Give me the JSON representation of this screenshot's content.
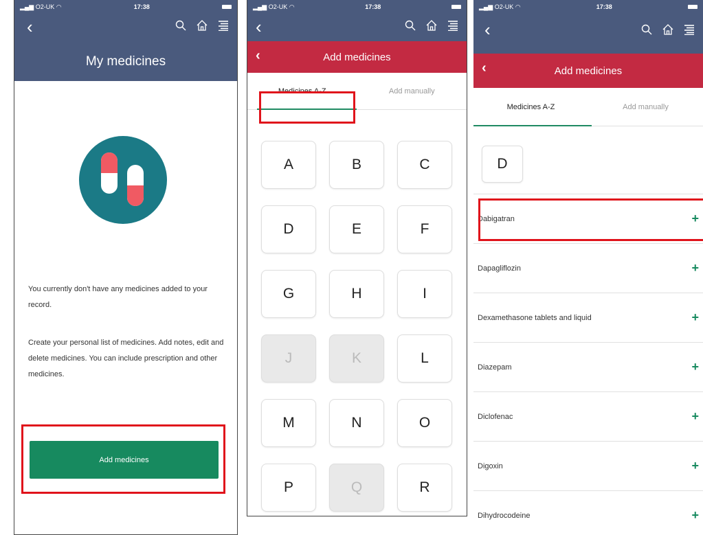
{
  "status": {
    "carrier": "O2-UK",
    "time": "17:38"
  },
  "panel1": {
    "title": "My medicines",
    "text1": "You currently don't have any medicines added to your record.",
    "text2": "Create your personal list of medicines. Add notes, edit and delete medicines. You can include prescription and other medicines.",
    "add_button": "Add medicines"
  },
  "panel2": {
    "title": "Add medicines",
    "tabs": [
      "Medicines A-Z",
      "Add manually"
    ],
    "letters": [
      {
        "l": "A",
        "enabled": true
      },
      {
        "l": "B",
        "enabled": true
      },
      {
        "l": "C",
        "enabled": true
      },
      {
        "l": "D",
        "enabled": true
      },
      {
        "l": "E",
        "enabled": true
      },
      {
        "l": "F",
        "enabled": true
      },
      {
        "l": "G",
        "enabled": true
      },
      {
        "l": "H",
        "enabled": true
      },
      {
        "l": "I",
        "enabled": true
      },
      {
        "l": "J",
        "enabled": false
      },
      {
        "l": "K",
        "enabled": false
      },
      {
        "l": "L",
        "enabled": true
      },
      {
        "l": "M",
        "enabled": true
      },
      {
        "l": "N",
        "enabled": true
      },
      {
        "l": "O",
        "enabled": true
      },
      {
        "l": "P",
        "enabled": true
      },
      {
        "l": "Q",
        "enabled": false
      },
      {
        "l": "R",
        "enabled": true
      }
    ]
  },
  "panel3": {
    "title": "Add medicines",
    "tabs": [
      "Medicines A-Z",
      "Add manually"
    ],
    "letter": "D",
    "medicines": [
      "Dabigatran",
      "Dapagliflozin",
      "Dexamethasone tablets and liquid",
      "Diazepam",
      "Diclofenac",
      "Digoxin",
      "Dihydrocodeine"
    ],
    "add_symbol": "+"
  },
  "colors": {
    "nav_blue": "#4a5a7d",
    "header_red": "#c32a42",
    "accent_green": "#178a5f",
    "highlight_red": "#e0131b",
    "pill_teal": "#1b7a86",
    "pill_red": "#f05a63"
  },
  "icons": [
    "back-chevron-icon",
    "search-icon",
    "home-icon",
    "menu-icon",
    "pills-icon",
    "plus-icon",
    "signal-icon",
    "wifi-icon",
    "battery-icon"
  ]
}
